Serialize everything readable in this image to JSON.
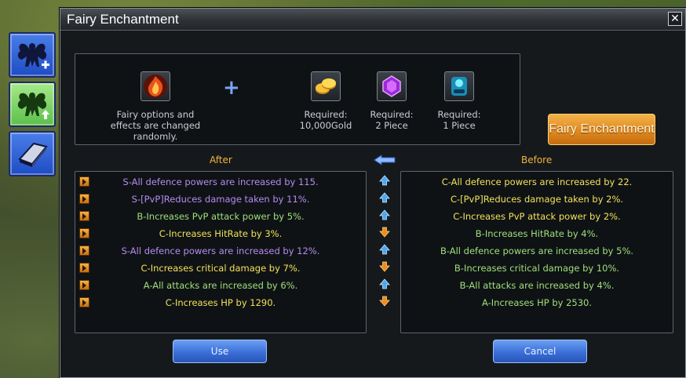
{
  "window": {
    "title": "Fairy Enchantment"
  },
  "requirements": {
    "fairy_item": {
      "icon": "fairy-flame-icon",
      "text": "Fairy options and effects are changed randomly."
    },
    "plus_symbol": "+",
    "gold": {
      "icon": "gold-coins-icon",
      "label": "Required:",
      "value": "10,000Gold"
    },
    "gem": {
      "icon": "purple-gem-icon",
      "label": "Required:",
      "value": "2 Piece"
    },
    "scroll": {
      "icon": "blue-scroll-icon",
      "label": "Required:",
      "value": "1 Piece"
    }
  },
  "buttons": {
    "enchant": "Fairy Enchantment",
    "use": "Use",
    "cancel": "Cancel"
  },
  "labels": {
    "after": "After",
    "before": "Before"
  },
  "grade_colors": {
    "S": "#b58cf0",
    "A": "#9fe07a",
    "B": "#9fe07a",
    "C": "#f2e25a"
  },
  "after": [
    {
      "grade": "S",
      "text": "S-All defence powers are increased by 115."
    },
    {
      "grade": "S",
      "text": "S-[PvP]Reduces damage taken by 11%."
    },
    {
      "grade": "B",
      "text": "B-Increases PvP attack power by 5%."
    },
    {
      "grade": "C",
      "text": "C-Increases HitRate by 3%."
    },
    {
      "grade": "S",
      "text": "S-All defence powers are increased by 12%."
    },
    {
      "grade": "C",
      "text": "C-Increases critical damage by 7%."
    },
    {
      "grade": "A",
      "text": "A-All attacks are increased by 6%."
    },
    {
      "grade": "C",
      "text": "C-Increases HP by 1290."
    }
  ],
  "trends": [
    "up",
    "up",
    "up",
    "down",
    "up",
    "down",
    "up",
    "down"
  ],
  "before": [
    {
      "grade": "C",
      "text": "C-All defence powers are increased by 22."
    },
    {
      "grade": "C",
      "text": "C-[PvP]Reduces damage taken by 2%."
    },
    {
      "grade": "C",
      "text": "C-Increases PvP attack power by 2%."
    },
    {
      "grade": "B",
      "text": "B-Increases HitRate by 4%."
    },
    {
      "grade": "B",
      "text": "B-All defence powers are increased by 5%."
    },
    {
      "grade": "B",
      "text": "B-Increases critical damage by 10%."
    },
    {
      "grade": "B",
      "text": "B-All attacks are increased by 4%."
    },
    {
      "grade": "A",
      "text": "A-Increases HP by 2530."
    }
  ]
}
